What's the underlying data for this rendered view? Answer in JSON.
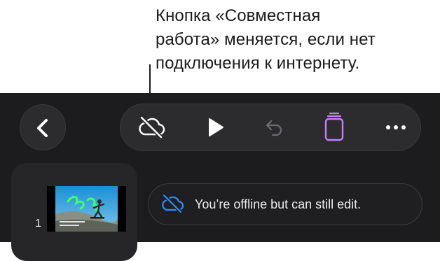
{
  "callout": {
    "text": "Кнопка «Совместная\nработа» меняется, если нет\nподключения к интернету."
  },
  "toolbar": {
    "back_icon": "chevron-left-icon",
    "items": [
      {
        "icon": "cloud-offline-icon",
        "state": "enabled"
      },
      {
        "icon": "play-icon",
        "state": "enabled"
      },
      {
        "icon": "undo-icon",
        "state": "disabled"
      },
      {
        "icon": "slides-icon",
        "state": "active",
        "color": "#c77dff"
      },
      {
        "icon": "more-icon",
        "state": "enabled"
      }
    ]
  },
  "navigator": {
    "slides": [
      {
        "number": "1"
      }
    ]
  },
  "offline_banner": {
    "icon": "cloud-offline-icon",
    "icon_color": "#2f8cff",
    "text": "You’re offline but can still edit."
  }
}
